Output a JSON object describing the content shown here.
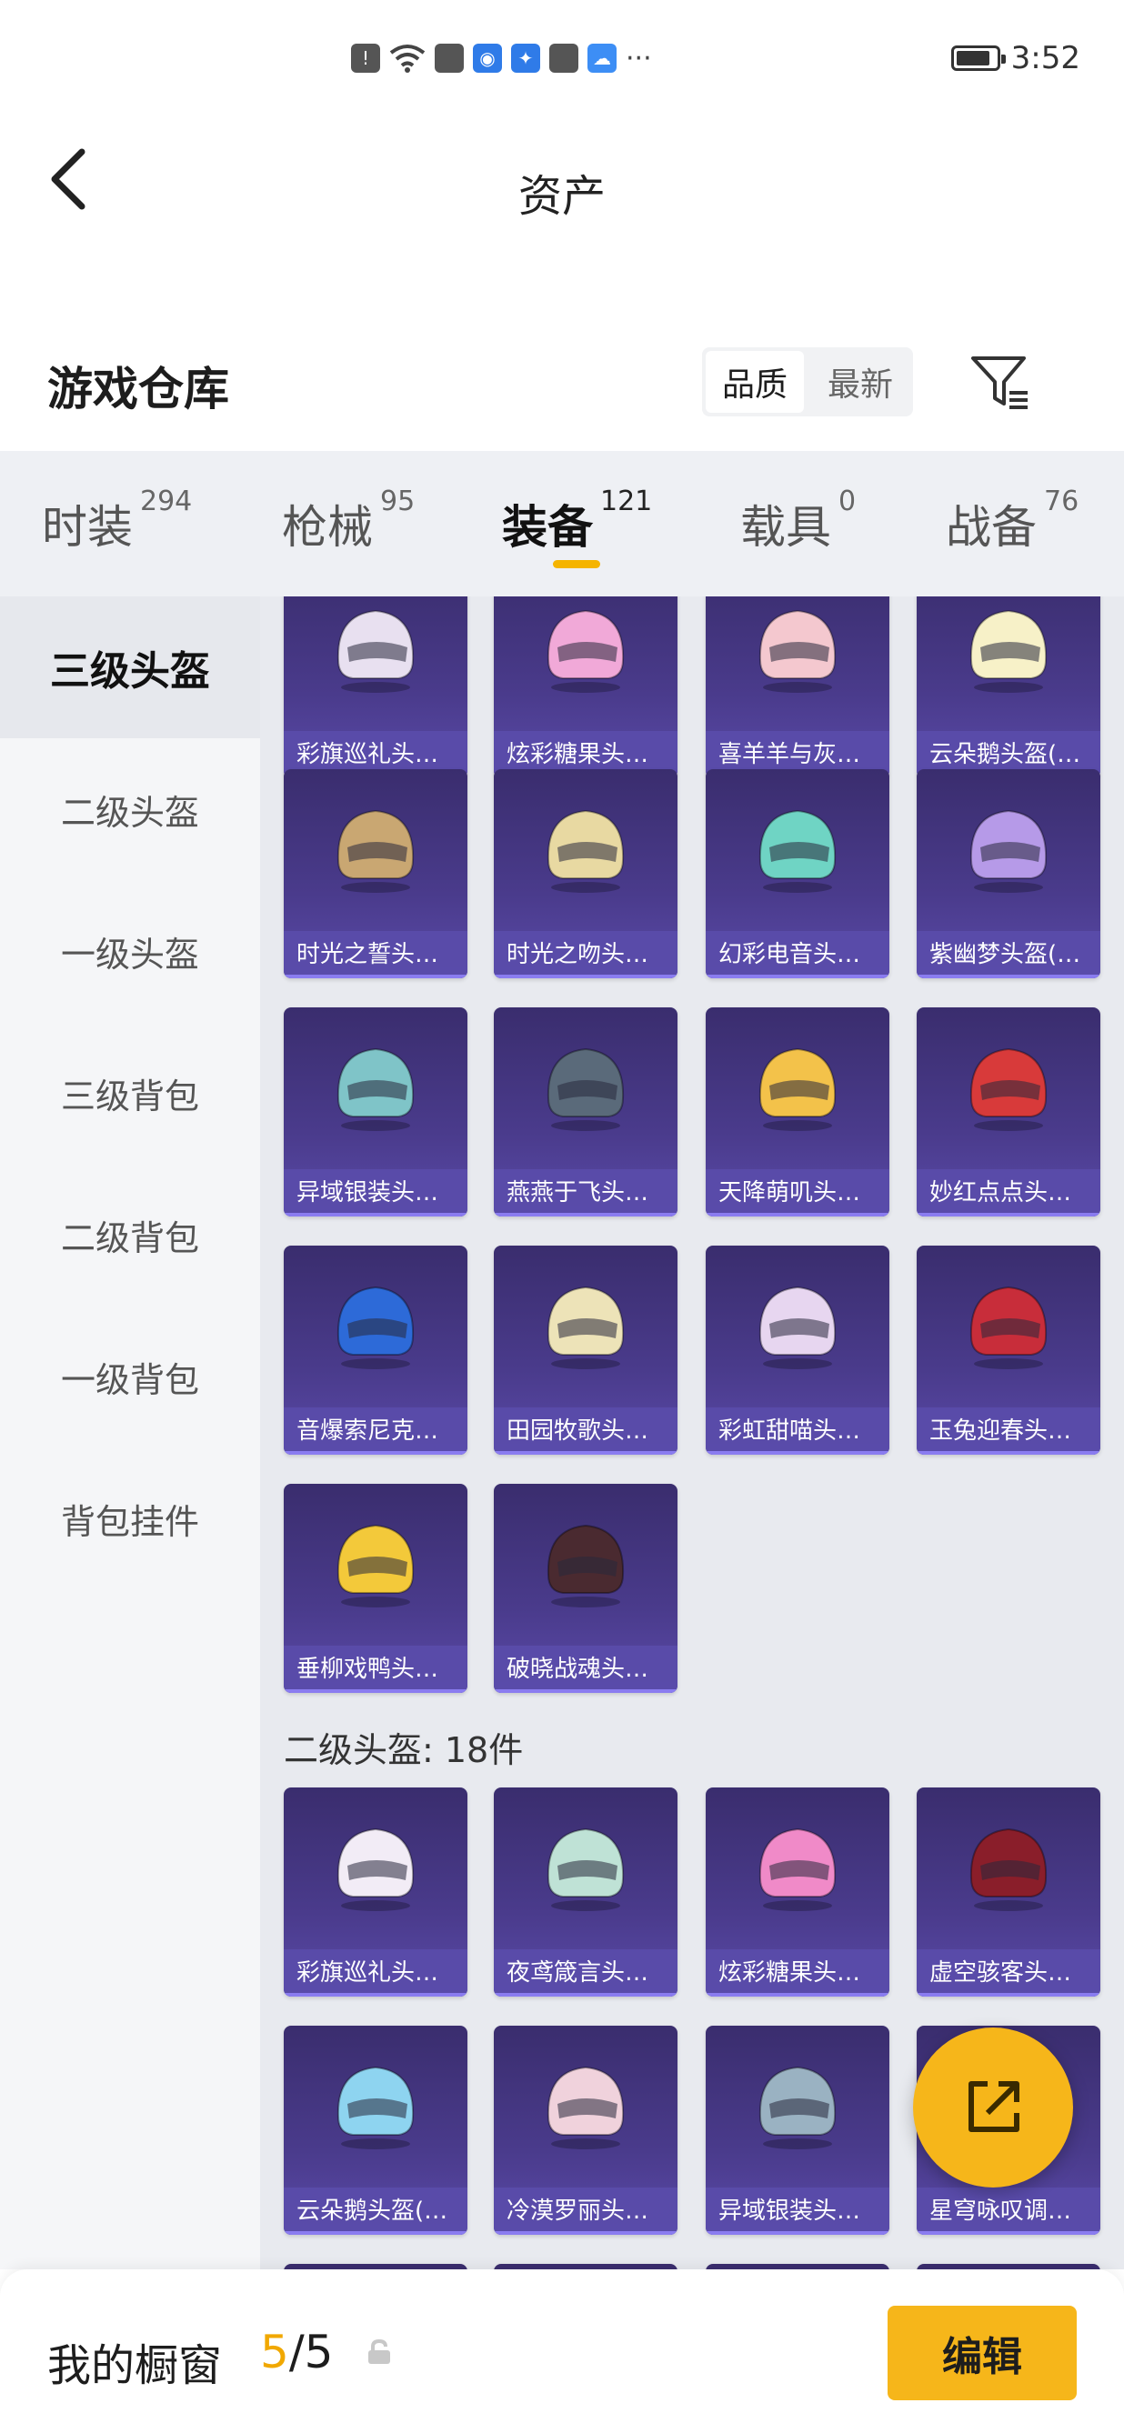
{
  "status_bar": {
    "time": "3:52",
    "more_icon": "···",
    "battery_level": 0.8,
    "icons": [
      "alert-icon",
      "wifi-icon",
      "app-icon",
      "globe-icon",
      "bulb-icon",
      "app-icon",
      "cloud-icon"
    ]
  },
  "header": {
    "title": "资产"
  },
  "section": {
    "title": "游戏仓库",
    "sort_options": [
      "品质",
      "最新"
    ],
    "sort_active": "品质"
  },
  "tabs": [
    {
      "label": "时装",
      "count": "294"
    },
    {
      "label": "枪械",
      "count": "95"
    },
    {
      "label": "装备",
      "count": "121",
      "active": true
    },
    {
      "label": "载具",
      "count": "0"
    },
    {
      "label": "战备",
      "count": "76"
    }
  ],
  "sidebar": {
    "items": [
      "三级头盔",
      "二级头盔",
      "一级头盔",
      "三级背包",
      "二级背包",
      "一级背包",
      "背包挂件"
    ],
    "active": "三级头盔"
  },
  "grid": {
    "rows_level3": [
      [
        "彩旗巡礼头…",
        "炫彩糖果头…",
        "喜羊羊与灰…",
        "云朵鹅头盔(…"
      ],
      [
        "时光之誓头…",
        "时光之吻头…",
        "幻彩电音头…",
        "紫幽梦头盔(…"
      ],
      [
        "异域银装头…",
        "燕燕于飞头…",
        "天降萌叽头…",
        "妙红点点头…"
      ],
      [
        "音爆索尼克…",
        "田园牧歌头…",
        "彩虹甜喵头…",
        "玉兔迎春头…"
      ],
      [
        "垂柳戏鸭头…",
        "破晓战魂头…"
      ]
    ],
    "group2_title": "二级头盔: 18件",
    "rows_level2": [
      [
        "彩旗巡礼头…",
        "夜鸢箴言头…",
        "炫彩糖果头…",
        "虚空骇客头…"
      ],
      [
        "云朵鹅头盔(…",
        "冷漠罗丽头…",
        "异域银装头…",
        "星穹咏叹调…"
      ]
    ]
  },
  "bottom": {
    "label": "我的橱窗",
    "count": "5",
    "separator": "/",
    "total": "5",
    "edit_label": "编辑"
  },
  "colors": {
    "accent": "#f6b61a",
    "card_bg": "#4a3b8c",
    "card_label_bg": "#5a4caa"
  }
}
